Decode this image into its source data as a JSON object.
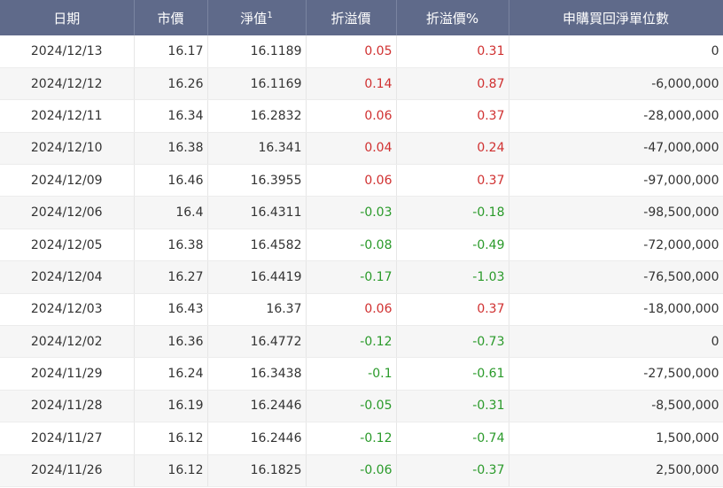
{
  "colors": {
    "header_bg": "#5f6a8a",
    "positive": "#d03030",
    "negative": "#2a9a2a"
  },
  "headers": {
    "date": "日期",
    "price": "市價",
    "nav": "淨值",
    "nav_sup": "1",
    "premium": "折溢價",
    "premium_pct": "折溢價%",
    "units": "申購買回淨單位數"
  },
  "rows": [
    [
      "2024/12/13",
      "16.17",
      "16.1189",
      "0.05",
      "0.31",
      "0"
    ],
    [
      "2024/12/12",
      "16.26",
      "16.1169",
      "0.14",
      "0.87",
      "-6,000,000"
    ],
    [
      "2024/12/11",
      "16.34",
      "16.2832",
      "0.06",
      "0.37",
      "-28,000,000"
    ],
    [
      "2024/12/10",
      "16.38",
      "16.341",
      "0.04",
      "0.24",
      "-47,000,000"
    ],
    [
      "2024/12/09",
      "16.46",
      "16.3955",
      "0.06",
      "0.37",
      "-97,000,000"
    ],
    [
      "2024/12/06",
      "16.4",
      "16.4311",
      "-0.03",
      "-0.18",
      "-98,500,000"
    ],
    [
      "2024/12/05",
      "16.38",
      "16.4582",
      "-0.08",
      "-0.49",
      "-72,000,000"
    ],
    [
      "2024/12/04",
      "16.27",
      "16.4419",
      "-0.17",
      "-1.03",
      "-76,500,000"
    ],
    [
      "2024/12/03",
      "16.43",
      "16.37",
      "0.06",
      "0.37",
      "-18,000,000"
    ],
    [
      "2024/12/02",
      "16.36",
      "16.4772",
      "-0.12",
      "-0.73",
      "0"
    ],
    [
      "2024/11/29",
      "16.24",
      "16.3438",
      "-0.1",
      "-0.61",
      "-27,500,000"
    ],
    [
      "2024/11/28",
      "16.19",
      "16.2446",
      "-0.05",
      "-0.31",
      "-8,500,000"
    ],
    [
      "2024/11/27",
      "16.12",
      "16.2446",
      "-0.12",
      "-0.74",
      "1,500,000"
    ],
    [
      "2024/11/26",
      "16.12",
      "16.1825",
      "-0.06",
      "-0.37",
      "2,500,000"
    ]
  ]
}
